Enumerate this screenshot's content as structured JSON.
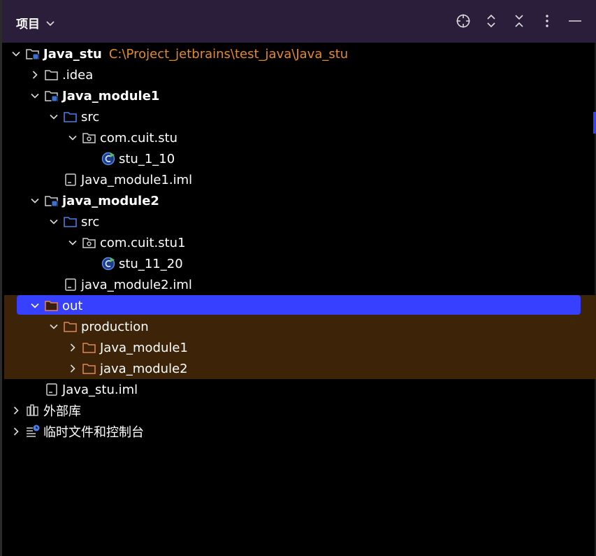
{
  "header": {
    "title": "项目"
  },
  "project": {
    "name": "Java_stu",
    "path": "C:\\Project_jetbrains\\test_java\\Java_stu"
  },
  "nodes": {
    "idea": ".idea",
    "module1": "Java_module1",
    "module1_src": "src",
    "module1_pkg": "com.cuit.stu",
    "module1_class": "stu_1_10",
    "module1_iml": "Java_module1.iml",
    "module2": "java_module2",
    "module2_src": "src",
    "module2_pkg": "com.cuit.stu1",
    "module2_class": "stu_11_20",
    "module2_iml": "java_module2.iml",
    "out": "out",
    "production": "production",
    "prod_module1": "Java_module1",
    "prod_module2": "java_module2",
    "root_iml": "Java_stu.iml",
    "external_libs": "外部库",
    "scratches": "临时文件和控制台"
  },
  "colors": {
    "header_bg": "#2a1e3b",
    "selection": "#3840ff",
    "excluded_band": "#3d2409",
    "path_text": "#e58a26",
    "folder_blue": "#4a7ee6",
    "folder_excluded": "#e0855a"
  }
}
